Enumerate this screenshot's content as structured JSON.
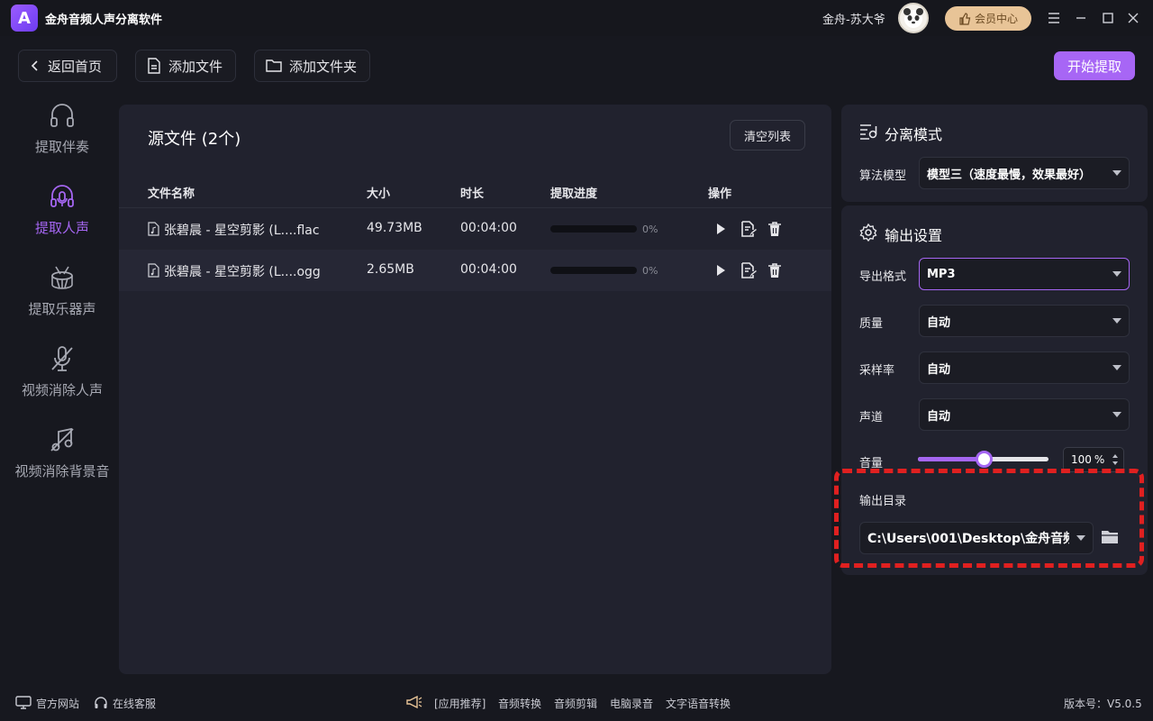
{
  "app": {
    "logo_letter": "A",
    "title": "金舟音频人声分离软件",
    "username": "金舟-苏大爷",
    "vip_label": "会员中心"
  },
  "toolbar": {
    "back_label": "返回首页",
    "add_file_label": "添加文件",
    "add_folder_label": "添加文件夹",
    "start_label": "开始提取"
  },
  "sidebar": {
    "items": [
      {
        "label": "提取伴奏",
        "icon": "headphones-icon",
        "active": false
      },
      {
        "label": "提取人声",
        "icon": "mic-headset-icon",
        "active": true
      },
      {
        "label": "提取乐器声",
        "icon": "drum-icon",
        "active": false
      },
      {
        "label": "视频消除人声",
        "icon": "mic-off-icon",
        "active": false
      },
      {
        "label": "视频消除背景音",
        "icon": "music-off-icon",
        "active": false
      }
    ]
  },
  "files": {
    "title": "源文件 (2个)",
    "clear_label": "清空列表",
    "columns": [
      "文件名称",
      "大小",
      "时长",
      "提取进度",
      "操作"
    ],
    "rows": [
      {
        "name": "张碧晨 - 星空剪影 (L....flac",
        "size": "49.73MB",
        "duration": "00:04:00",
        "progress": "0%",
        "progress_value": 0
      },
      {
        "name": "张碧晨 - 星空剪影 (L....ogg",
        "size": "2.65MB",
        "duration": "00:04:00",
        "progress": "0%",
        "progress_value": 0
      }
    ]
  },
  "mode": {
    "title": "分离模式",
    "algo_label": "算法模型",
    "algo_value": "模型三（速度最慢，效果最好）"
  },
  "output": {
    "title": "输出设置",
    "format_label": "导出格式",
    "format_value": "MP3",
    "quality_label": "质量",
    "quality_value": "自动",
    "samplerate_label": "采样率",
    "samplerate_value": "自动",
    "channel_label": "声道",
    "channel_value": "自动",
    "volume_label": "音量",
    "volume_value": "100",
    "volume_unit": "%",
    "volume_fraction": 0.5,
    "dir_label": "输出目录",
    "dir_value": "C:\\Users\\001\\Desktop\\金舟音频人"
  },
  "footer": {
    "website": "官方网站",
    "service": "在线客服",
    "recommend": "[应用推荐]",
    "links": [
      "音频转换",
      "音频剪辑",
      "电脑录音",
      "文字语音转换"
    ],
    "version": "版本号：V5.0.5"
  },
  "colors": {
    "accent": "#a566f2",
    "highlight": "#e02020",
    "vip": "#e8c497"
  }
}
